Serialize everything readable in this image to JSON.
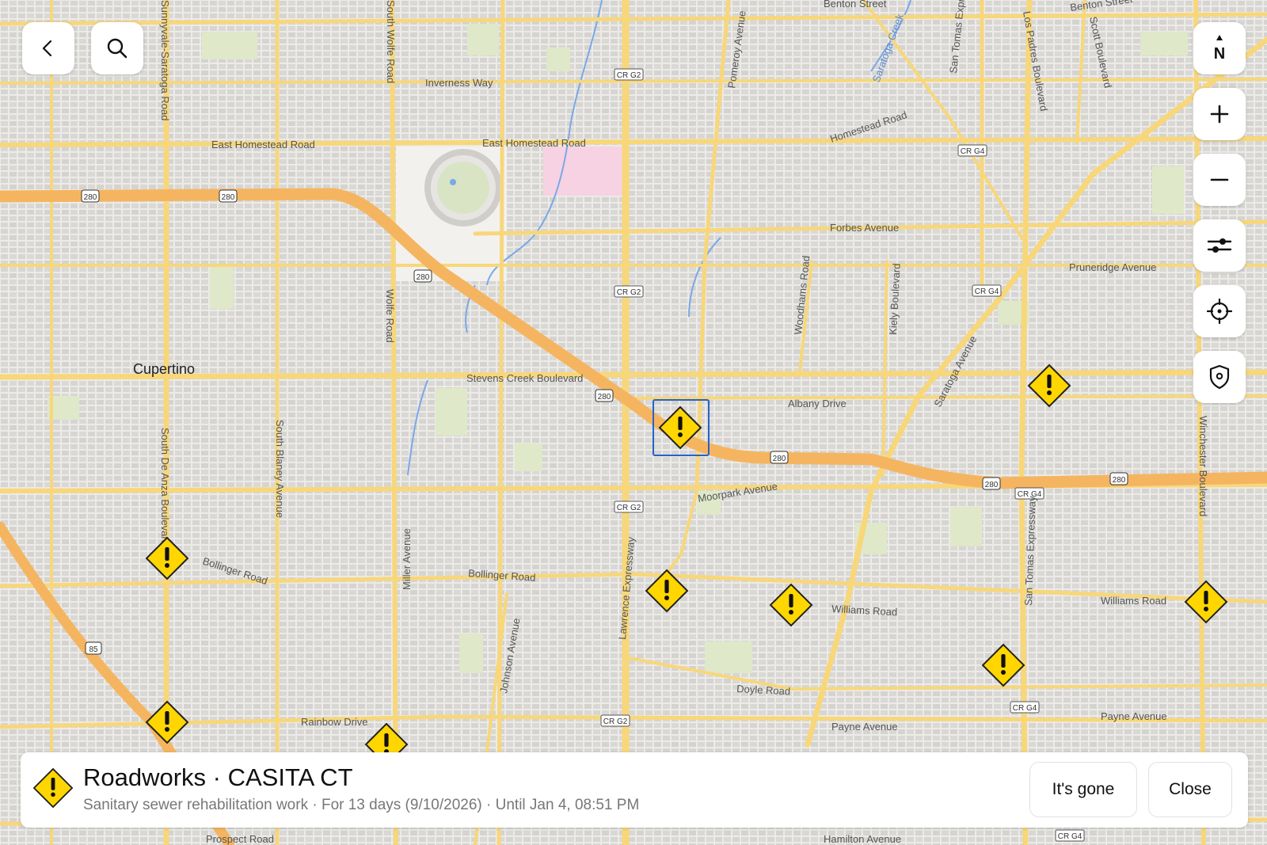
{
  "map": {
    "place_labels": {
      "cupertino": "Cupertino"
    },
    "street_labels": {
      "benton_st_1": "Benton Street",
      "benton_st_2": "Benton Street",
      "inverness_way": "Inverness Way",
      "east_homestead_1": "East Homestead Road",
      "east_homestead_2": "East Homestead Road",
      "homestead_road": "Homestead Road",
      "forbes_ave": "Forbes Avenue",
      "pruneridge_ave": "Pruneridge Avenue",
      "stevens_creek": "Stevens Creek Boulevard",
      "albany_drive": "Albany Drive",
      "moorpark_ave": "Moorpark Avenue",
      "bollinger_1": "Bollinger Road",
      "bollinger_2": "Bollinger Road",
      "williams_1": "Williams Road",
      "williams_2": "Williams Road",
      "doyle_road": "Doyle Road",
      "payne_1": "Payne Avenue",
      "payne_2": "Payne Avenue",
      "rainbow_drive": "Rainbow Drive",
      "prospect_road": "Prospect Road",
      "hamilton_ave": "Hamilton Avenue",
      "south_wolfe": "South Wolfe Road",
      "wolfe_road": "Wolfe Road",
      "saratoga_road": "Sunnyvale-Saratoga Road",
      "south_de_anza": "South De Anza Boulevard",
      "south_blaney": "South Blaney Avenue",
      "miller_ave": "Miller Avenue",
      "johnson_ave": "Johnson Avenue",
      "lawrence_expwy": "Lawrence Expressway",
      "pomeroy_ave": "Pomeroy Avenue",
      "woodhams_road": "Woodhams Road",
      "kiely_blvd": "Kiely Boulevard",
      "saratoga_ave": "Saratoga Avenue",
      "san_tomas_1": "San Tomas Expressway",
      "san_tomas_2": "San Tomas Expressway",
      "los_padres": "Los Padres Boulevard",
      "scott_blvd": "Scott Boulevard",
      "winchester_blvd": "Winchester Boulevard",
      "saratoga_creek": "Saratoga Creek"
    },
    "shields": {
      "i280": "280",
      "cr_g2": "CR G2",
      "cr_g4": "CR G4",
      "sr85": "85"
    },
    "incident_markers_count": 10
  },
  "controls": {
    "back": "back-icon",
    "search": "search-icon",
    "compass": "N",
    "zoom_in": "plus-icon",
    "zoom_out": "minus-icon",
    "filters": "sliders-icon",
    "locate": "crosshair-icon",
    "safety": "shield-icon"
  },
  "incident": {
    "title": "Roadworks · CASITA CT",
    "description": "Sanitary sewer rehabilitation work · For 13 days (9/10/2026) · Until Jan 4, 08:51 PM",
    "gone_button": "It's gone",
    "close_button": "Close"
  },
  "colors": {
    "major_road": "#f8d77a",
    "highway": "#f5b560",
    "warning_yellow": "#ffd600",
    "park_green": "#dfe8c8",
    "water_blue": "#7aa8e8",
    "selection_blue": "#2563c9"
  }
}
